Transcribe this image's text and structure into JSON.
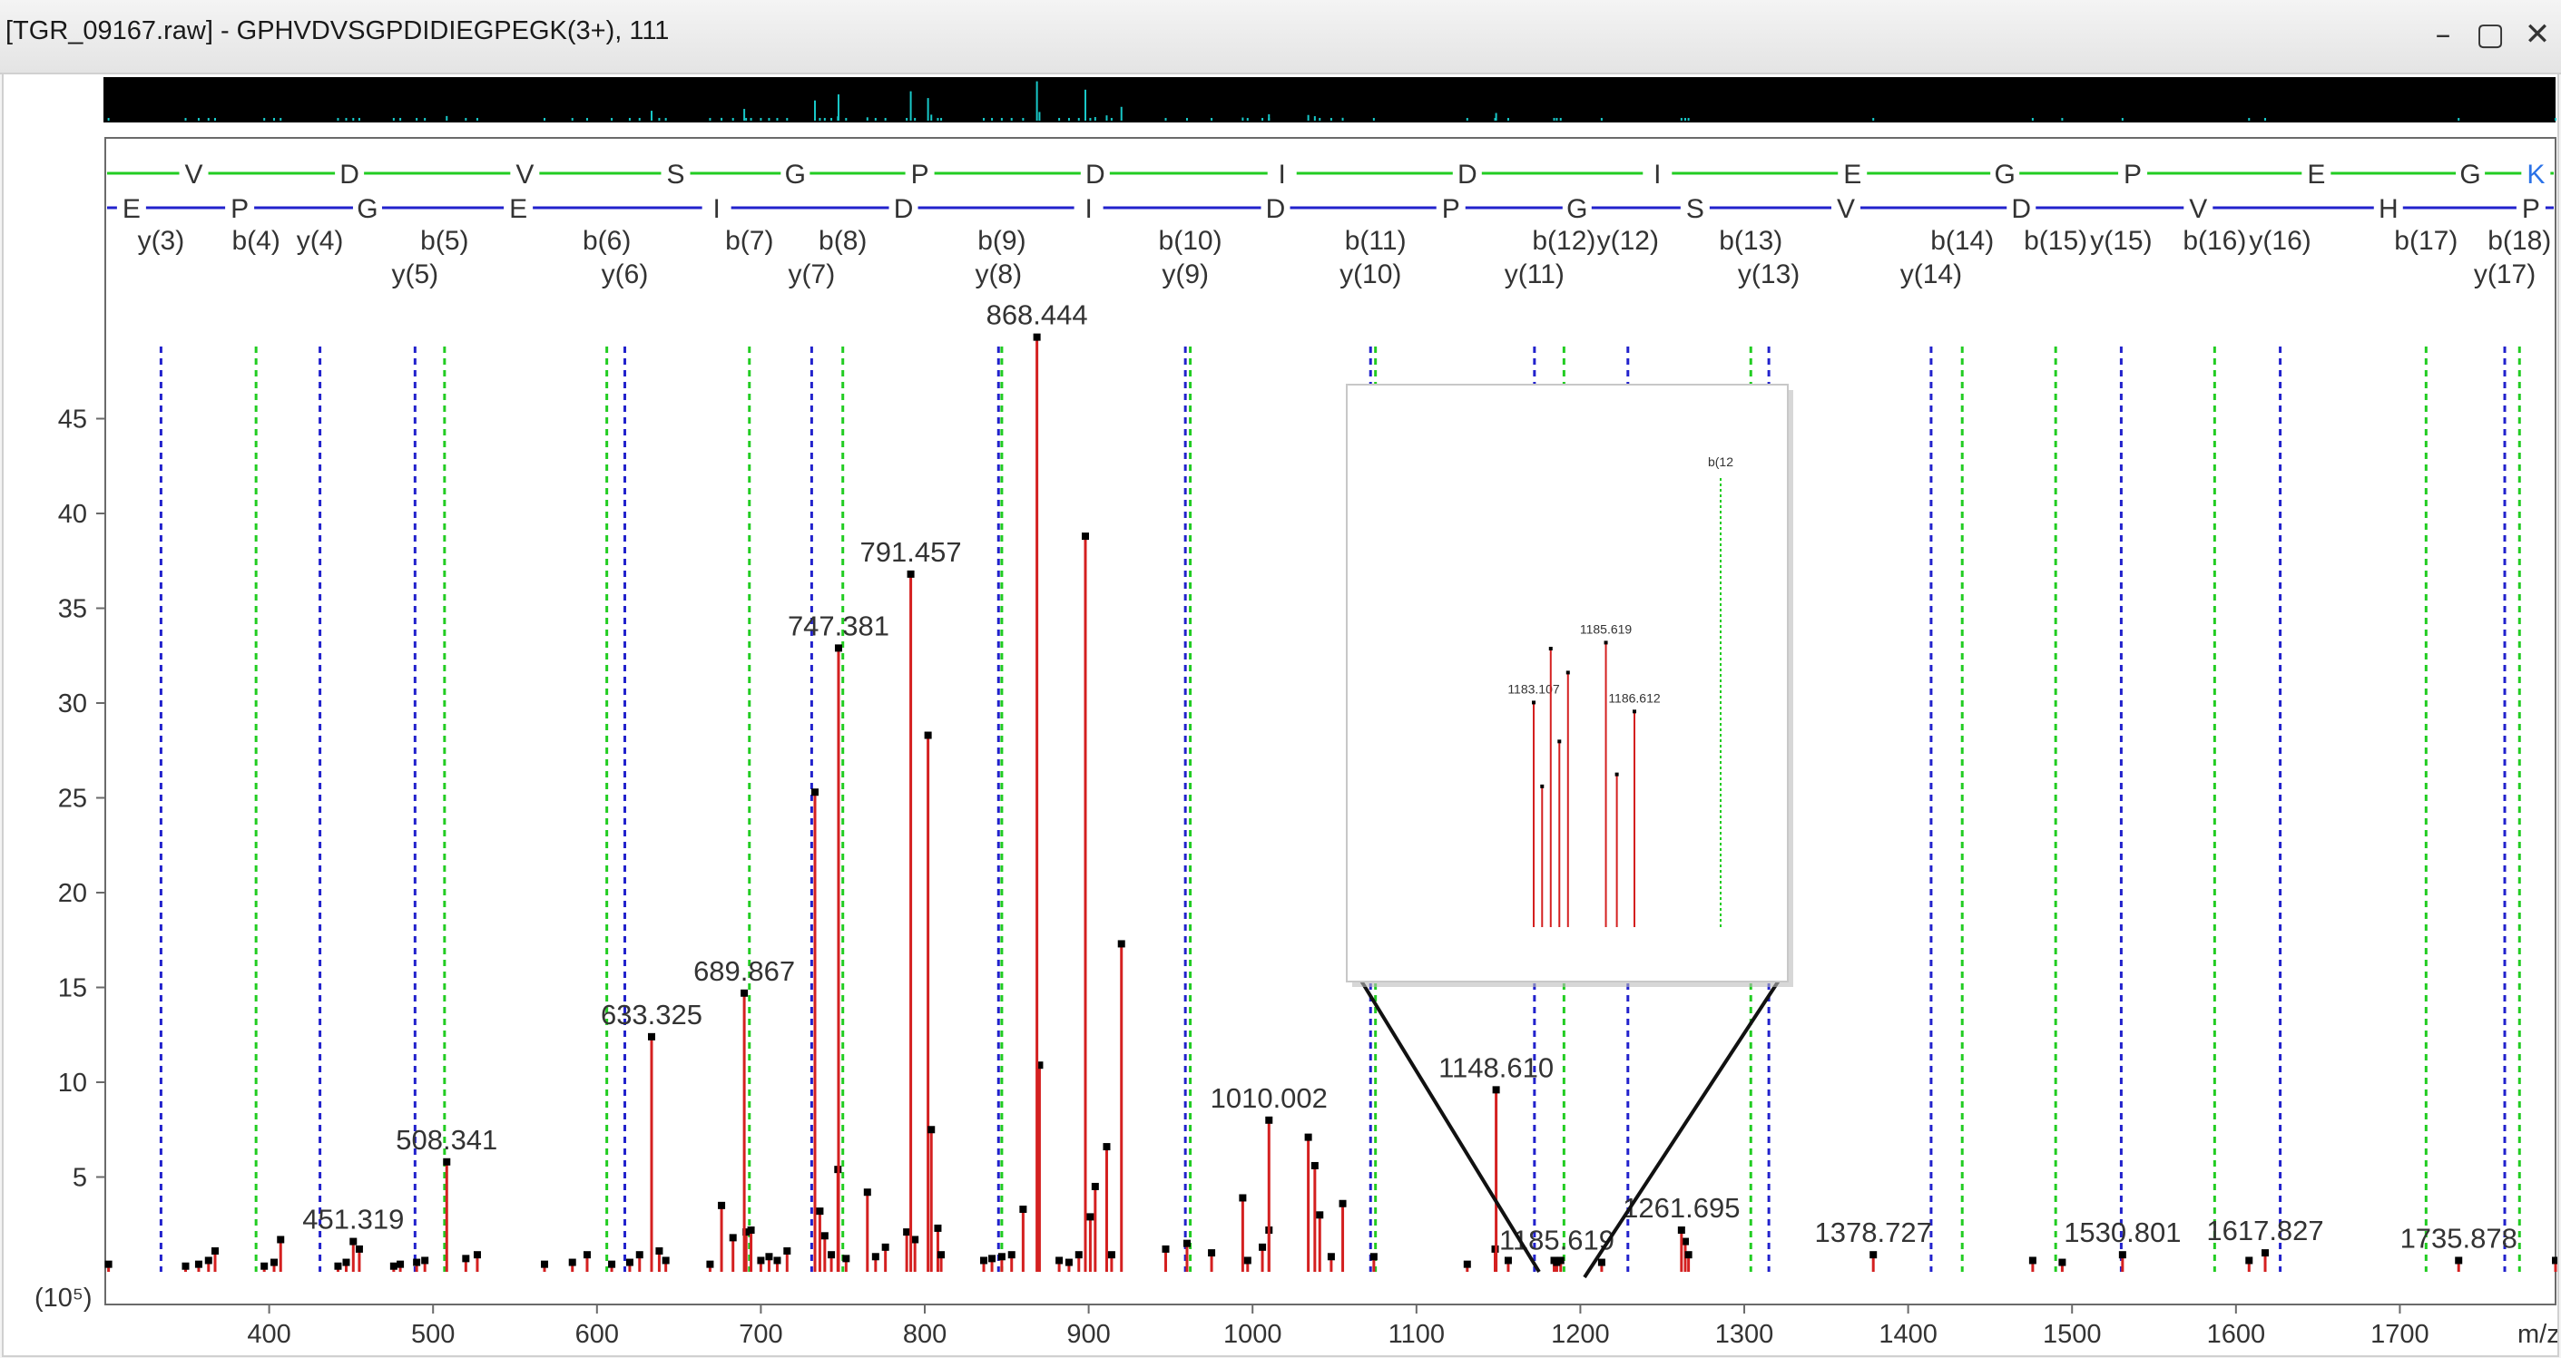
{
  "window": {
    "title": "[TGR_09167.raw] - GPHVDVSGPDIDIEGPEGK(3+), 111",
    "minimize_icon": "minimize-icon",
    "maximize_icon": "maximize-icon",
    "close_icon": "close-icon"
  },
  "colors": {
    "peak": "#d42020",
    "b_ion": "#22cc22",
    "y_ion": "#2222cc",
    "overview_bg": "#000000",
    "overview_peak": "#18c8c8"
  },
  "chart_data": {
    "type": "bar",
    "xlabel": "m/z",
    "ylabel": "(10⁵)",
    "xlim": [
      300,
      1795
    ],
    "ylim": [
      0,
      51
    ],
    "x_ticks": [
      400,
      500,
      600,
      700,
      800,
      900,
      1000,
      1100,
      1200,
      1300,
      1400,
      1500,
      1600,
      1700
    ],
    "y_ticks": [
      5,
      10,
      15,
      20,
      25,
      30,
      35,
      40,
      45
    ],
    "b_sequence": [
      {
        "aa": "V",
        "mz": 354
      },
      {
        "aa": "D",
        "mz": 449
      },
      {
        "aa": "V",
        "mz": 556
      },
      {
        "aa": "S",
        "mz": 648
      },
      {
        "aa": "G",
        "mz": 721
      },
      {
        "aa": "P",
        "mz": 797
      },
      {
        "aa": "D",
        "mz": 904
      },
      {
        "aa": "I",
        "mz": 1018
      },
      {
        "aa": "D",
        "mz": 1131
      },
      {
        "aa": "I",
        "mz": 1247
      },
      {
        "aa": "E",
        "mz": 1366
      },
      {
        "aa": "G",
        "mz": 1459
      },
      {
        "aa": "P",
        "mz": 1537
      },
      {
        "aa": "E",
        "mz": 1649
      },
      {
        "aa": "G",
        "mz": 1743
      },
      {
        "aa": "K",
        "mz": 1783
      }
    ],
    "y_sequence": [
      {
        "aa": "E",
        "mz": 316
      },
      {
        "aa": "P",
        "mz": 382
      },
      {
        "aa": "G",
        "mz": 460
      },
      {
        "aa": "E",
        "mz": 552
      },
      {
        "aa": "I",
        "mz": 673
      },
      {
        "aa": "D",
        "mz": 787
      },
      {
        "aa": "I",
        "mz": 900
      },
      {
        "aa": "D",
        "mz": 1014
      },
      {
        "aa": "P",
        "mz": 1121
      },
      {
        "aa": "G",
        "mz": 1198
      },
      {
        "aa": "S",
        "mz": 1270
      },
      {
        "aa": "V",
        "mz": 1362
      },
      {
        "aa": "D",
        "mz": 1469
      },
      {
        "aa": "V",
        "mz": 1577
      },
      {
        "aa": "H",
        "mz": 1693
      },
      {
        "aa": "P",
        "mz": 1780
      }
    ],
    "b_ions": [
      {
        "label": "b(4)",
        "mz": 392
      },
      {
        "label": "b(5)",
        "mz": 507
      },
      {
        "label": "b(6)",
        "mz": 606
      },
      {
        "label": "b(7)",
        "mz": 693
      },
      {
        "label": "b(8)",
        "mz": 750
      },
      {
        "label": "b(9)",
        "mz": 847
      },
      {
        "label": "b(10)",
        "mz": 962
      },
      {
        "label": "b(11)",
        "mz": 1075
      },
      {
        "label": "b(12)",
        "mz": 1190
      },
      {
        "label": "b(13)",
        "mz": 1304
      },
      {
        "label": "b(14)",
        "mz": 1433
      },
      {
        "label": "b(15)",
        "mz": 1490
      },
      {
        "label": "b(16)",
        "mz": 1587
      },
      {
        "label": "b(17)",
        "mz": 1716
      },
      {
        "label": "b(18)",
        "mz": 1773
      }
    ],
    "y_ions": [
      {
        "label": "y(3)",
        "mz": 334
      },
      {
        "label": "y(4)",
        "mz": 431
      },
      {
        "label": "y(5)",
        "mz": 489
      },
      {
        "label": "y(6)",
        "mz": 617
      },
      {
        "label": "y(7)",
        "mz": 731
      },
      {
        "label": "y(8)",
        "mz": 845
      },
      {
        "label": "y(9)",
        "mz": 959
      },
      {
        "label": "y(10)",
        "mz": 1072
      },
      {
        "label": "y(11)",
        "mz": 1172
      },
      {
        "label": "y(12)",
        "mz": 1229
      },
      {
        "label": "y(13)",
        "mz": 1315
      },
      {
        "label": "y(14)",
        "mz": 1414
      },
      {
        "label": "y(15)",
        "mz": 1530
      },
      {
        "label": "y(16)",
        "mz": 1627
      },
      {
        "label": "y(17)",
        "mz": 1764
      }
    ],
    "labeled_peaks": [
      {
        "mz": 451.319,
        "intensity": 1.6
      },
      {
        "mz": 508.341,
        "intensity": 5.8
      },
      {
        "mz": 633.325,
        "intensity": 12.4
      },
      {
        "mz": 689.867,
        "intensity": 14.7
      },
      {
        "mz": 747.381,
        "intensity": 32.9
      },
      {
        "mz": 791.457,
        "intensity": 36.8
      },
      {
        "mz": 868.444,
        "intensity": 49.3
      },
      {
        "mz": 1010.002,
        "intensity": 8.0
      },
      {
        "mz": 1148.61,
        "intensity": 9.6
      },
      {
        "mz": 1185.619,
        "intensity": 0.5
      },
      {
        "mz": 1261.695,
        "intensity": 2.2
      },
      {
        "mz": 1378.727,
        "intensity": 0.9
      },
      {
        "mz": 1530.801,
        "intensity": 0.9
      },
      {
        "mz": 1617.827,
        "intensity": 1.0
      },
      {
        "mz": 1735.878,
        "intensity": 0.6
      }
    ],
    "other_peaks": [
      [
        302,
        0.4
      ],
      [
        349,
        0.3
      ],
      [
        357,
        0.4
      ],
      [
        363,
        0.6
      ],
      [
        367,
        1.1
      ],
      [
        397,
        0.3
      ],
      [
        403,
        0.5
      ],
      [
        407,
        1.7
      ],
      [
        442,
        0.3
      ],
      [
        447,
        0.5
      ],
      [
        455,
        1.2
      ],
      [
        476,
        0.3
      ],
      [
        480,
        0.4
      ],
      [
        490,
        0.5
      ],
      [
        495,
        0.6
      ],
      [
        520,
        0.7
      ],
      [
        527,
        0.9
      ],
      [
        568,
        0.4
      ],
      [
        585,
        0.5
      ],
      [
        594,
        0.9
      ],
      [
        609,
        0.4
      ],
      [
        620,
        0.5
      ],
      [
        626,
        0.9
      ],
      [
        638,
        1.1
      ],
      [
        642,
        0.6
      ],
      [
        669,
        0.4
      ],
      [
        676,
        3.5
      ],
      [
        683,
        1.8
      ],
      [
        691,
        2.1
      ],
      [
        694,
        2.2
      ],
      [
        700,
        0.6
      ],
      [
        705,
        0.8
      ],
      [
        710,
        0.6
      ],
      [
        716,
        1.1
      ],
      [
        733,
        25.3
      ],
      [
        736,
        3.2
      ],
      [
        739,
        1.9
      ],
      [
        743,
        0.9
      ],
      [
        747,
        5.4
      ],
      [
        752,
        0.7
      ],
      [
        765,
        4.2
      ],
      [
        770,
        0.8
      ],
      [
        776,
        1.3
      ],
      [
        789,
        2.1
      ],
      [
        794,
        1.7
      ],
      [
        802,
        28.3
      ],
      [
        804,
        7.5
      ],
      [
        808,
        2.3
      ],
      [
        810,
        0.9
      ],
      [
        836,
        0.6
      ],
      [
        841,
        0.7
      ],
      [
        847,
        0.8
      ],
      [
        853,
        0.9
      ],
      [
        860,
        3.3
      ],
      [
        870,
        10.9
      ],
      [
        882,
        0.6
      ],
      [
        888,
        0.5
      ],
      [
        894,
        0.9
      ],
      [
        898,
        38.8
      ],
      [
        901,
        2.9
      ],
      [
        904,
        4.5
      ],
      [
        911,
        6.6
      ],
      [
        914,
        0.9
      ],
      [
        920,
        17.3
      ],
      [
        947,
        1.2
      ],
      [
        960,
        1.5
      ],
      [
        975,
        1.0
      ],
      [
        994,
        3.9
      ],
      [
        997,
        0.6
      ],
      [
        1006,
        1.3
      ],
      [
        1010,
        2.2
      ],
      [
        1034,
        7.1
      ],
      [
        1038,
        5.6
      ],
      [
        1041,
        3.0
      ],
      [
        1048,
        0.8
      ],
      [
        1055,
        3.6
      ],
      [
        1074,
        0.8
      ],
      [
        1131,
        0.4
      ],
      [
        1148,
        1.2
      ],
      [
        1156,
        0.6
      ],
      [
        1184,
        0.6
      ],
      [
        1188,
        0.6
      ],
      [
        1213,
        0.5
      ],
      [
        1264,
        1.6
      ],
      [
        1266,
        0.9
      ],
      [
        1476,
        0.6
      ],
      [
        1494,
        0.5
      ],
      [
        1608,
        0.6
      ],
      [
        1795,
        0.6
      ]
    ],
    "inset": {
      "ion_label": "b(12",
      "peaks": [
        {
          "mz": 1183.107,
          "intensity": 0.75,
          "label": "1183.107"
        },
        {
          "mz": 1183.4,
          "intensity": 0.47,
          "label": ""
        },
        {
          "mz": 1183.7,
          "intensity": 0.93,
          "label": ""
        },
        {
          "mz": 1184.0,
          "intensity": 0.62,
          "label": ""
        },
        {
          "mz": 1184.3,
          "intensity": 0.85,
          "label": ""
        },
        {
          "mz": 1185.619,
          "intensity": 0.95,
          "label": "1185.619"
        },
        {
          "mz": 1186.0,
          "intensity": 0.51,
          "label": ""
        },
        {
          "mz": 1186.612,
          "intensity": 0.72,
          "label": "1186.612"
        }
      ]
    }
  }
}
